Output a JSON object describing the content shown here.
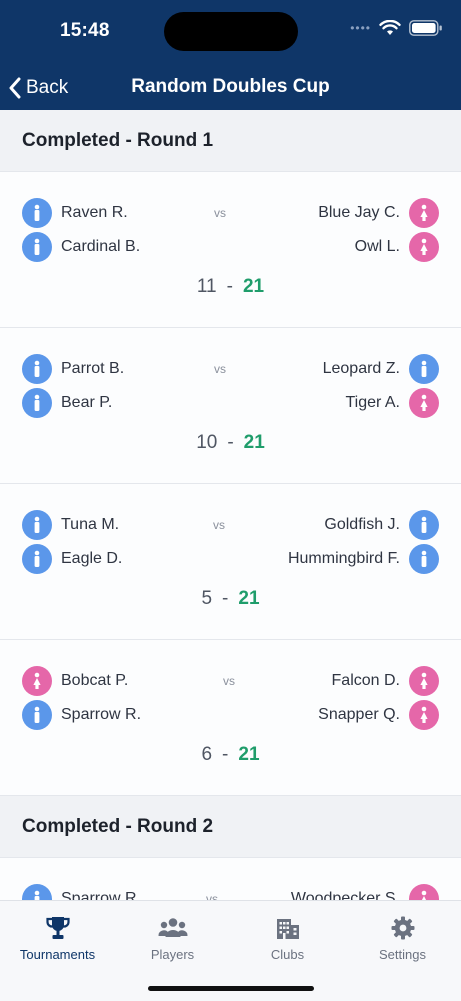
{
  "status": {
    "time": "15:48"
  },
  "nav": {
    "back_label": "Back",
    "title": "Random Doubles Cup"
  },
  "sections": [
    {
      "title": "Completed - Round 1"
    },
    {
      "title": "Completed - Round 2"
    }
  ],
  "vs_label": "vs",
  "score_separator": "-",
  "matches": [
    {
      "left": [
        {
          "name": "Raven R.",
          "gender": "male"
        },
        {
          "name": "Cardinal B.",
          "gender": "male"
        }
      ],
      "right": [
        {
          "name": "Blue Jay C.",
          "gender": "female"
        },
        {
          "name": "Owl L.",
          "gender": "female"
        }
      ],
      "score_left": "11",
      "score_right": "21"
    },
    {
      "left": [
        {
          "name": "Parrot B.",
          "gender": "male"
        },
        {
          "name": "Bear P.",
          "gender": "male"
        }
      ],
      "right": [
        {
          "name": "Leopard Z.",
          "gender": "male"
        },
        {
          "name": "Tiger A.",
          "gender": "female"
        }
      ],
      "score_left": "10",
      "score_right": "21"
    },
    {
      "left": [
        {
          "name": "Tuna M.",
          "gender": "male"
        },
        {
          "name": "Eagle D.",
          "gender": "male"
        }
      ],
      "right": [
        {
          "name": "Goldfish J.",
          "gender": "male"
        },
        {
          "name": "Hummingbird F.",
          "gender": "male"
        }
      ],
      "score_left": "5",
      "score_right": "21"
    },
    {
      "left": [
        {
          "name": "Bobcat P.",
          "gender": "female"
        },
        {
          "name": "Sparrow R.",
          "gender": "male"
        }
      ],
      "right": [
        {
          "name": "Falcon D.",
          "gender": "female"
        },
        {
          "name": "Snapper Q.",
          "gender": "female"
        }
      ],
      "score_left": "6",
      "score_right": "21"
    },
    {
      "left": [
        {
          "name": "Sparrow R.",
          "gender": "male"
        },
        {
          "name": "",
          "gender": "male"
        }
      ],
      "right": [
        {
          "name": "Woodpecker S.",
          "gender": "female"
        },
        {
          "name": "",
          "gender": "female"
        }
      ],
      "score_left": "",
      "score_right": ""
    }
  ],
  "tabs": [
    {
      "label": "Tournaments",
      "icon": "trophy-icon",
      "active": true
    },
    {
      "label": "Players",
      "icon": "people-icon",
      "active": false
    },
    {
      "label": "Clubs",
      "icon": "building-icon",
      "active": false
    },
    {
      "label": "Settings",
      "icon": "gear-icon",
      "active": false
    }
  ],
  "colors": {
    "header": "#0f3668",
    "male_avatar": "#5b97ea",
    "female_avatar": "#e567a9",
    "winner_score": "#1f9d6b"
  }
}
